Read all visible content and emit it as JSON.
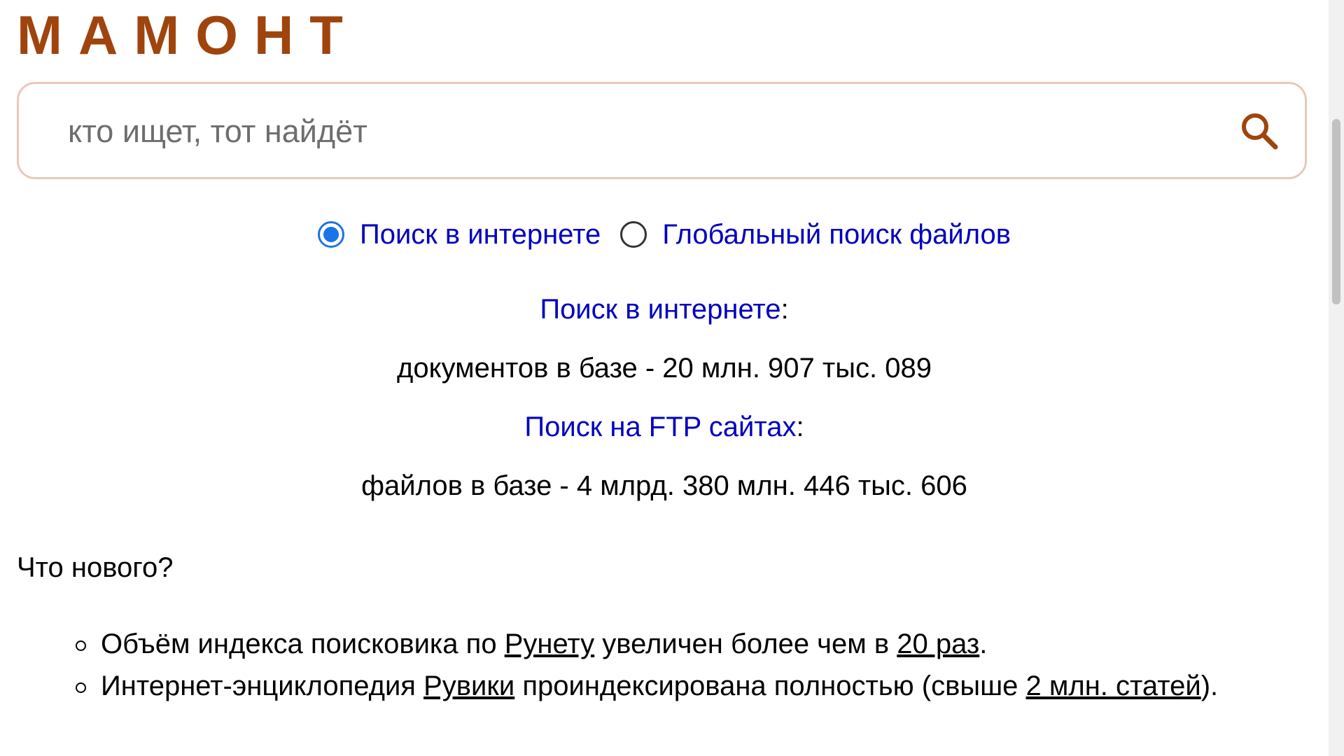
{
  "logo": {
    "text": "МАМОНТ"
  },
  "search": {
    "placeholder": "кто ищет, тот найдёт",
    "value": ""
  },
  "search_mode": {
    "options": [
      {
        "label": "Поиск в интернете",
        "checked": true
      },
      {
        "label": "Глобальный поиск файлов",
        "checked": false
      }
    ]
  },
  "stats": {
    "web_title": "Поиск в интернете",
    "web_title_suffix": ":",
    "web_count": "документов в базе - 20 млн. 907 тыс. 089",
    "ftp_title": "Поиск на FTP сайтах",
    "ftp_title_suffix": ":",
    "ftp_count": "файлов в базе - 4 млрд. 380 млн. 446 тыс. 606"
  },
  "news": {
    "heading": "Что нового?",
    "items": [
      {
        "t1": "Объём индекса поисковика по ",
        "link1": "Рунету",
        "t2": " увеличен более чем в ",
        "link2": "20 раз",
        "t3": "."
      },
      {
        "t1": "Интернет-энциклопедия ",
        "link1": "Рувики",
        "t2": " проиндексирована полностью (свыше ",
        "link2": "2 млн. статей",
        "t3": ")."
      }
    ]
  },
  "colors": {
    "brand": "#a0440d",
    "link": "#0000c0",
    "radio_accent": "#1a73e8",
    "search_border": "#e9c8b8"
  },
  "icons": {
    "search": "search-icon"
  }
}
